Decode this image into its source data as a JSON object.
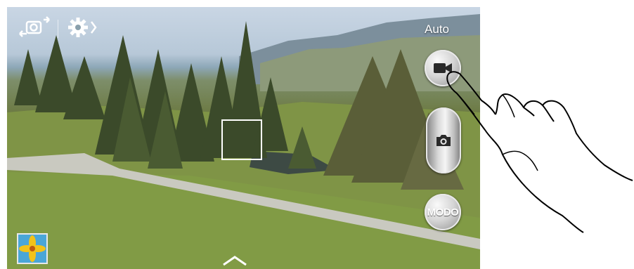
{
  "camera": {
    "mode_label": "Auto",
    "modo_button_label": "MODO"
  },
  "icons": {
    "switch_camera": "switch-camera-icon",
    "settings": "settings-gear-icon",
    "video": "video-camera-icon",
    "photo": "photo-camera-icon",
    "gallery": "gallery-thumbnail",
    "expand": "chevron-up-icon"
  },
  "colors": {
    "button_silver": "#d6d6d6",
    "focus_box": "#ffffff"
  }
}
